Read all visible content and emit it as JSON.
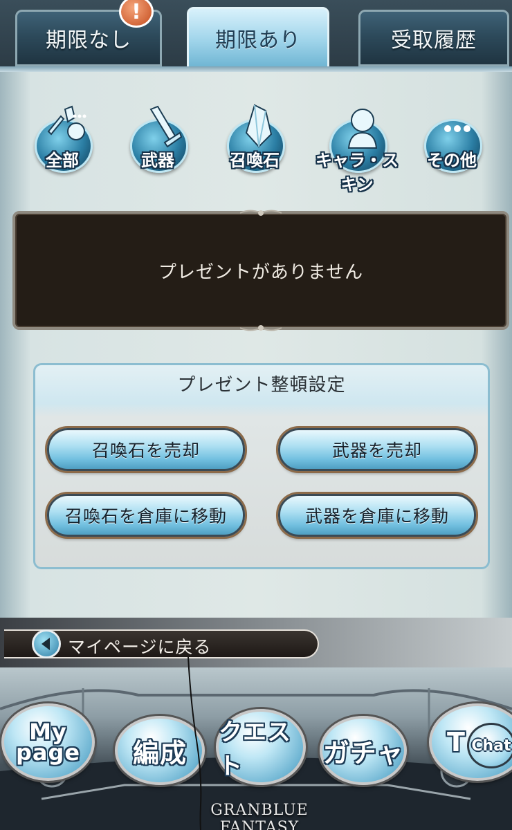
{
  "tabs": [
    {
      "label": "期限なし",
      "active": false,
      "badge": "!"
    },
    {
      "label": "期限あり",
      "active": true
    },
    {
      "label": "受取履歴",
      "active": false
    }
  ],
  "categories": [
    {
      "label": "全部",
      "icon": "all-items-icon"
    },
    {
      "label": "武器",
      "icon": "sword-icon"
    },
    {
      "label": "召喚石",
      "icon": "crystal-icon"
    },
    {
      "label": "キャラ・スキン",
      "icon": "character-icon"
    },
    {
      "label": "その他",
      "icon": "more-icon"
    }
  ],
  "message": {
    "empty": "プレゼントがありません"
  },
  "sort_settings": {
    "title": "プレゼント整頓設定",
    "buttons": [
      "召喚石を売却",
      "武器を売却",
      "召喚石を倉庫に移動",
      "武器を倉庫に移動"
    ]
  },
  "back": {
    "label": "マイページに戻る"
  },
  "nav": {
    "mypage": "My page",
    "party": "編成",
    "quest": "クエスト",
    "gacha": "ガチャ",
    "partial": "T",
    "chat": "Chat",
    "logo": "GRANBLUE FANTASY"
  },
  "colors": {
    "accent": "#6fb5d3",
    "badge": "#d4582a",
    "message_bg": "#241d16"
  }
}
